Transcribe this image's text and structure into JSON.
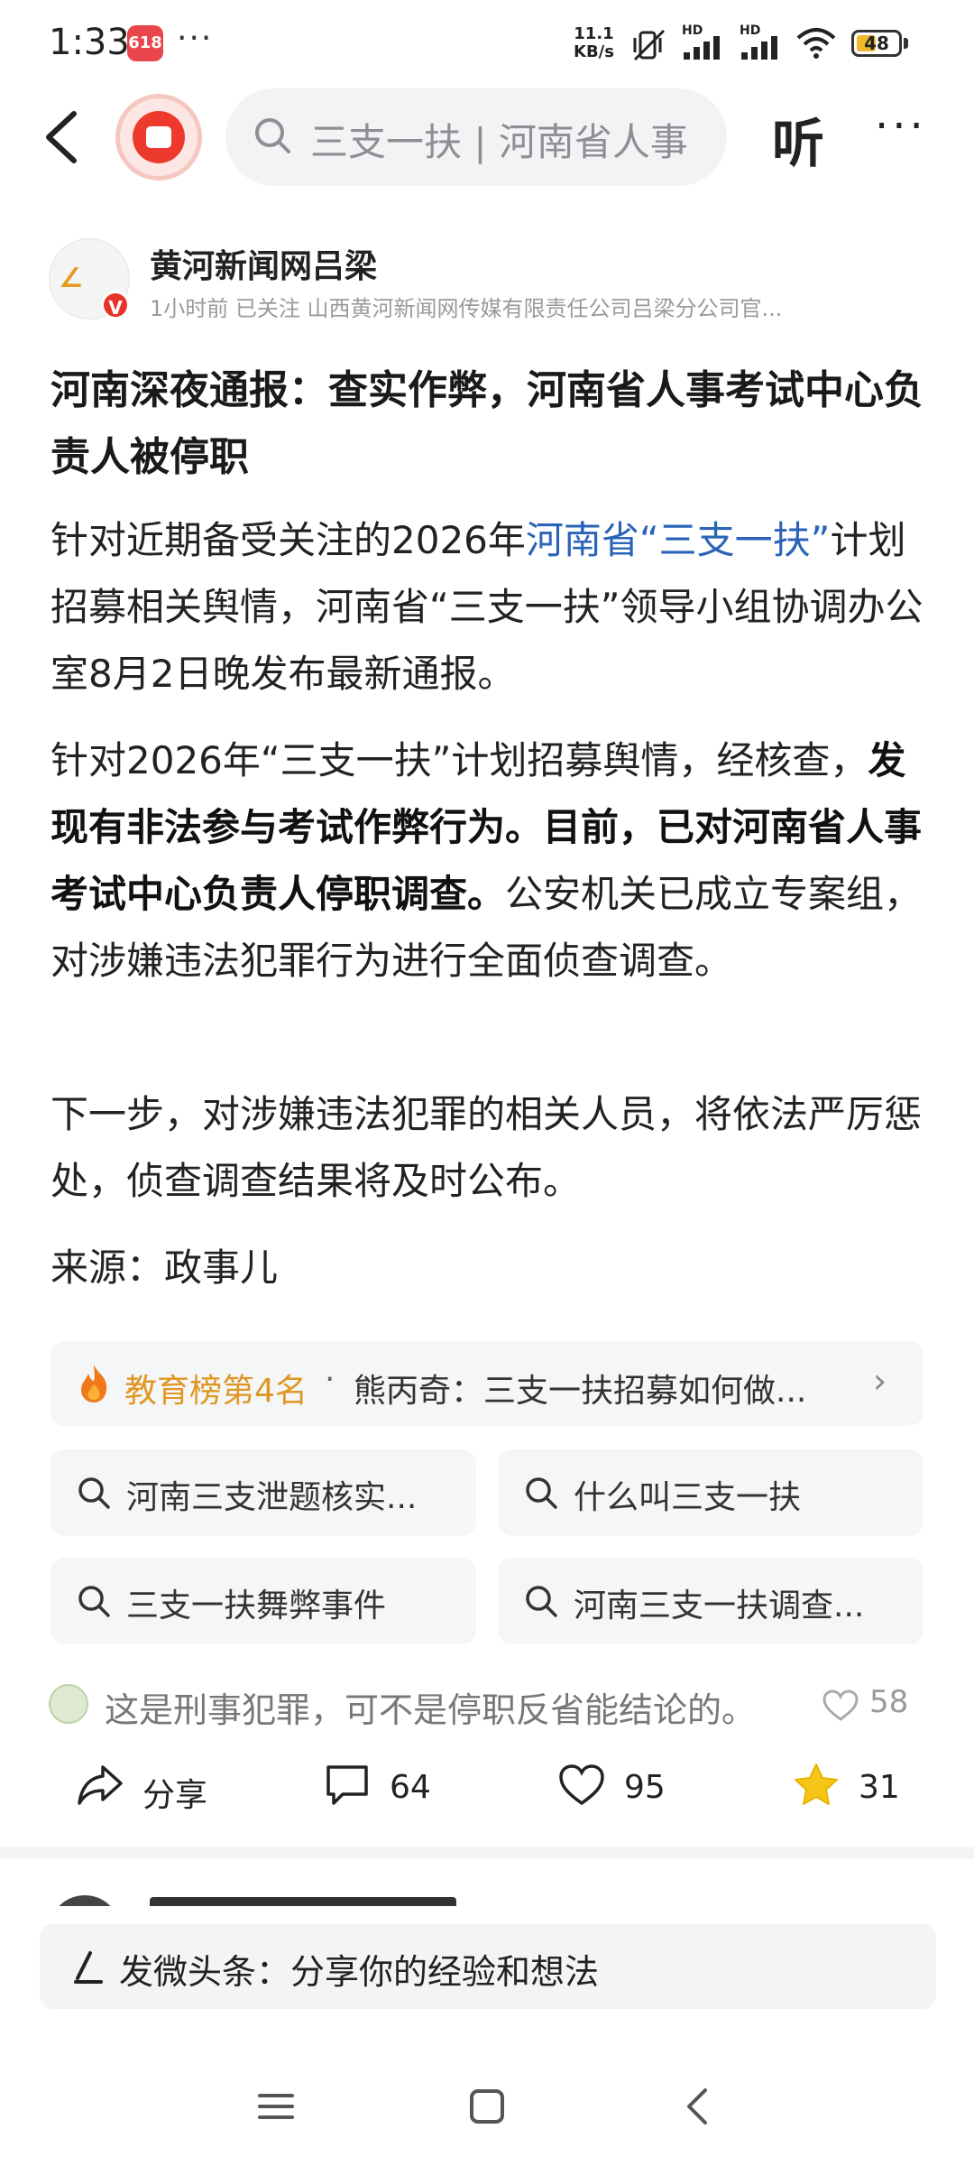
{
  "status_bar": {
    "time": "1:33",
    "app_badge": "618",
    "dots": "···",
    "net_speed_value": "11.1",
    "net_speed_unit": "KB/s",
    "signal_1_label": "HD",
    "signal_2_label": "HD",
    "battery": "48",
    "battery_level": 0.48
  },
  "nav": {
    "search_text": "三支一扶 | 河南省人事",
    "listen_label": "听",
    "more_label": "···"
  },
  "author": {
    "name": "黄河新闻网吕梁",
    "meta": "1小时前   已关注   山西黄河新闻网传媒有限责任公司吕梁分公司官...",
    "verified": "V"
  },
  "article": {
    "title": "河南深夜通报：查实作弊，河南省人事考试中心负责人被停职",
    "p1_a": "针对近期备受关注的2026年",
    "p1_link1": "河南省",
    "p1_link2": "“三支一扶”",
    "p1_b": "计划招募相关舆情，河南省“三支一扶”领导小组协调办公室8月2日晚发布最新通报。",
    "p2_a": "针对2026年“三支一扶”计划招募舆情，经核查，",
    "p2_bold": "发现有非法参与考试作弊行为。目前，已对河南省人事考试中心负责人停职调查。",
    "p2_b": "公安机关已成立专案组，对涉嫌违法犯罪行为进行全面侦查调查。",
    "p3": "下一步，对涉嫌违法犯罪的相关人员，将依法严厉惩处，侦查调查结果将及时公布。",
    "source": "来源：政事儿"
  },
  "rank": {
    "label": "教育榜第4名",
    "dot": "·",
    "text": "熊丙奇：三支一扶招募如何做...",
    "chevron": "›"
  },
  "suggestions": [
    "河南三支泄题核实...",
    "什么叫三支一扶",
    "三支一扶舞弊事件",
    "河南三支一扶调查..."
  ],
  "hot_comment": {
    "text": "这是刑事犯罪，可不是停职反省能结论的。",
    "likes": "58"
  },
  "actions": {
    "share": "分享",
    "comments": "64",
    "likes": "95",
    "favorites": "31"
  },
  "composer": {
    "placeholder": "发微头条：分享你的经验和想法"
  },
  "colors": {
    "link": "#2a63b8",
    "rank_orange": "#e09622",
    "star": "#f5c518",
    "brand_red": "#ee3a2e"
  }
}
